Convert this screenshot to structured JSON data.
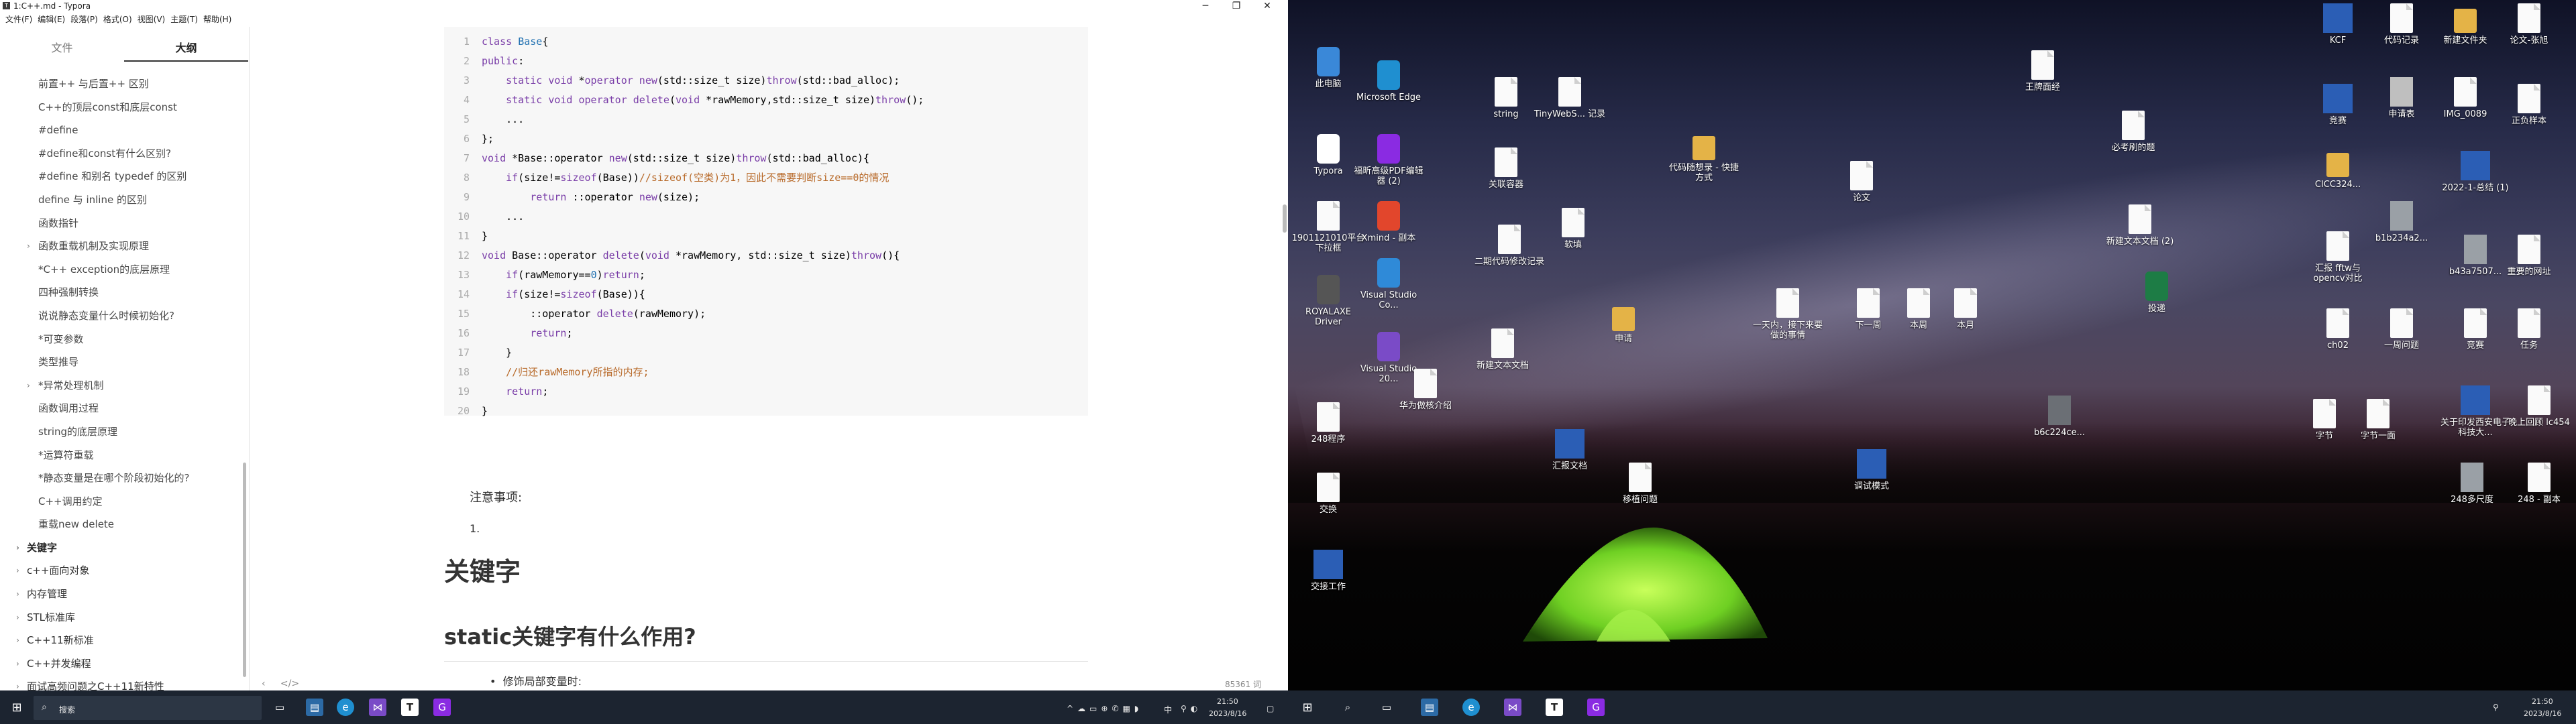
{
  "window": {
    "title": "1:C++.md - Typora",
    "icon": "T"
  },
  "menu": [
    "文件(F)",
    "编辑(E)",
    "段落(P)",
    "格式(O)",
    "视图(V)",
    "主题(T)",
    "帮助(H)"
  ],
  "sidebar": {
    "tabs": [
      "文件",
      "大纲"
    ],
    "outline": [
      {
        "label": "前置++ 与后置++ 区别",
        "level": 2
      },
      {
        "label": "C++的顶层const和底层const",
        "level": 2
      },
      {
        "label": "#define",
        "level": 2
      },
      {
        "label": "#define和const有什么区别?",
        "level": 2
      },
      {
        "label": "#define 和别名 typedef 的区别",
        "level": 2
      },
      {
        "label": "define 与 inline 的区别",
        "level": 2
      },
      {
        "label": "函数指针",
        "level": 2
      },
      {
        "label": "函数重载机制及实现原理",
        "level": 2,
        "arrow": "›"
      },
      {
        "label": "*C++ exception的底层原理",
        "level": 2
      },
      {
        "label": "四种强制转换",
        "level": 2
      },
      {
        "label": "说说静态变量什么时候初始化?",
        "level": 2
      },
      {
        "label": "*可变参数",
        "level": 2
      },
      {
        "label": "类型推导",
        "level": 2
      },
      {
        "label": "*异常处理机制",
        "level": 2,
        "arrow": "›"
      },
      {
        "label": "函数调用过程",
        "level": 2
      },
      {
        "label": "string的底层原理",
        "level": 2
      },
      {
        "label": "*运算符重载",
        "level": 2
      },
      {
        "label": "*静态变量是在哪个阶段初始化的?",
        "level": 2
      },
      {
        "label": "C++调用约定",
        "level": 2
      },
      {
        "label": "重载new delete",
        "level": 2
      },
      {
        "label": "关键字",
        "level": 1,
        "arrow": "›",
        "bold": true
      },
      {
        "label": "c++面向对象",
        "level": 1,
        "arrow": "›"
      },
      {
        "label": "内存管理",
        "level": 1,
        "arrow": "›"
      },
      {
        "label": "STL标准库",
        "level": 1,
        "arrow": "›"
      },
      {
        "label": "C++11新标准",
        "level": 1,
        "arrow": "›"
      },
      {
        "label": "C++并发编程",
        "level": 1,
        "arrow": "›"
      },
      {
        "label": "面试高频问题之C++11新特性",
        "level": 1,
        "arrow": "›"
      }
    ]
  },
  "code": [
    {
      "n": "1",
      "parts": [
        [
          "kw",
          "class "
        ],
        [
          "cls",
          "Base"
        ],
        [
          "",
          "{"
        ]
      ]
    },
    {
      "n": "2",
      "parts": [
        [
          "kw",
          "public"
        ],
        [
          "",
          ":"
        ]
      ]
    },
    {
      "n": "3",
      "parts": [
        [
          "",
          "    "
        ],
        [
          "kw",
          "static void "
        ],
        [
          "",
          "*"
        ],
        [
          "kw",
          "operator new"
        ],
        [
          "",
          "(std::size_t size)"
        ],
        [
          "kw",
          "throw"
        ],
        [
          "",
          "(std::bad_alloc);"
        ]
      ]
    },
    {
      "n": "4",
      "parts": [
        [
          "",
          "    "
        ],
        [
          "kw",
          "static void operator delete"
        ],
        [
          "",
          "("
        ],
        [
          "kw",
          "void"
        ],
        [
          "",
          " *rawMemory,std::size_t size)"
        ],
        [
          "kw",
          "throw"
        ],
        [
          "",
          "();"
        ]
      ]
    },
    {
      "n": "5",
      "parts": [
        [
          "",
          "    ..."
        ]
      ]
    },
    {
      "n": "6",
      "parts": [
        [
          "",
          "};"
        ]
      ]
    },
    {
      "n": "7",
      "parts": [
        [
          "kw",
          "void "
        ],
        [
          "",
          "*Base::operator "
        ],
        [
          "kw",
          "new"
        ],
        [
          "",
          "(std::size_t size)"
        ],
        [
          "kw",
          "throw"
        ],
        [
          "",
          "(std::bad_alloc){"
        ]
      ]
    },
    {
      "n": "8",
      "parts": [
        [
          "",
          "    "
        ],
        [
          "kw",
          "if"
        ],
        [
          "",
          "(size!="
        ],
        [
          "kw",
          "sizeof"
        ],
        [
          "",
          "(Base))"
        ],
        [
          "cm",
          "//sizeof(空类)为1，因此不需要判断size==0的情况"
        ]
      ]
    },
    {
      "n": "9",
      "parts": [
        [
          "",
          "        "
        ],
        [
          "kw",
          "return "
        ],
        [
          "",
          "::operator "
        ],
        [
          "kw",
          "new"
        ],
        [
          "",
          "(size);"
        ]
      ]
    },
    {
      "n": "10",
      "parts": [
        [
          "",
          "    ..."
        ]
      ]
    },
    {
      "n": "11",
      "parts": [
        [
          "",
          "}"
        ]
      ]
    },
    {
      "n": "12",
      "parts": [
        [
          "kw",
          "void "
        ],
        [
          "",
          "Base::operator "
        ],
        [
          "kw",
          "delete"
        ],
        [
          "",
          "("
        ],
        [
          "kw",
          "void"
        ],
        [
          "",
          " *rawMemory, std::size_t size)"
        ],
        [
          "kw",
          "throw"
        ],
        [
          "",
          "(){"
        ]
      ]
    },
    {
      "n": "13",
      "parts": [
        [
          "",
          "    "
        ],
        [
          "kw",
          "if"
        ],
        [
          "",
          "(rawMemory=="
        ],
        [
          "cls",
          "0"
        ],
        [
          "",
          ")"
        ],
        [
          "kw",
          "return"
        ],
        [
          "",
          ";"
        ]
      ]
    },
    {
      "n": "14",
      "parts": [
        [
          "",
          "    "
        ],
        [
          "kw",
          "if"
        ],
        [
          "",
          "(size!="
        ],
        [
          "kw",
          "sizeof"
        ],
        [
          "",
          "(Base)){"
        ]
      ]
    },
    {
      "n": "15",
      "parts": [
        [
          "",
          "        ::operator "
        ],
        [
          "kw",
          "delete"
        ],
        [
          "",
          "(rawMemory);"
        ]
      ]
    },
    {
      "n": "16",
      "parts": [
        [
          "",
          "        "
        ],
        [
          "kw",
          "return"
        ],
        [
          "",
          ";"
        ]
      ]
    },
    {
      "n": "17",
      "parts": [
        [
          "",
          "    }"
        ]
      ]
    },
    {
      "n": "18",
      "parts": [
        [
          "",
          "    "
        ],
        [
          "cm",
          "//归还rawMemory所指的内存;"
        ]
      ]
    },
    {
      "n": "19",
      "parts": [
        [
          "",
          "    "
        ],
        [
          "kw",
          "return"
        ],
        [
          "",
          ";"
        ]
      ]
    },
    {
      "n": "20",
      "parts": [
        [
          "",
          "}"
        ]
      ]
    }
  ],
  "doc": {
    "note": "注意事项:",
    "ol_num": "1.",
    "h1": "关键字",
    "h2": "static关键字有什么作用?",
    "bullet": "修饰局部变量时:",
    "word_count": "85361 词"
  },
  "taskbar_left": {
    "search": "搜索",
    "time": "21:50",
    "date": "2023/8/16",
    "ime": "中"
  },
  "taskbar_right": {
    "time": "21:50",
    "date": "2023/8/16"
  },
  "desktop_icons": [
    {
      "label": "此电脑",
      "type": "app",
      "color": "#3a88d8"
    },
    {
      "label": "Microsoft Edge",
      "type": "app",
      "color": "#1f8fd0"
    },
    {
      "label": "Typora",
      "type": "app",
      "color": "#ffffff"
    },
    {
      "label": "福昕高级PDF编辑器 (2)",
      "type": "app",
      "color": "#8a2be2"
    },
    {
      "label": "1901121010平台下拉框",
      "type": "doc",
      "color": "#fafafa"
    },
    {
      "label": "Xmind - 副本",
      "type": "app",
      "color": "#e2462c"
    },
    {
      "label": "ROYALAXE Driver",
      "type": "app",
      "color": "#555"
    },
    {
      "label": "Visual Studio Co...",
      "type": "app",
      "color": "#2f8ad8"
    },
    {
      "label": "Visual Studio 20...",
      "type": "app",
      "color": "#7a4bc7"
    },
    {
      "label": "华为做核介绍",
      "type": "doc",
      "color": "#fafafa"
    },
    {
      "label": "248程序",
      "type": "doc",
      "color": "#fafafa"
    },
    {
      "label": "交换",
      "type": "doc",
      "color": "#fafafa"
    },
    {
      "label": "交接工作",
      "type": "word",
      "color": "#2b5eb5"
    },
    {
      "label": "string",
      "type": "doc",
      "color": "#fafafa"
    },
    {
      "label": "TinyWebS... 记录",
      "type": "doc",
      "color": "#fafafa"
    },
    {
      "label": "关联容器",
      "type": "doc",
      "color": "#fafafa"
    },
    {
      "label": "二期代码修改记录",
      "type": "doc",
      "color": "#fafafa"
    },
    {
      "label": "软填",
      "type": "doc",
      "color": "#fafafa"
    },
    {
      "label": "新建文本文档",
      "type": "doc",
      "color": "#fafafa"
    },
    {
      "label": "申请",
      "type": "folder",
      "color": "#e4b347"
    },
    {
      "label": "汇报文档",
      "type": "word",
      "color": "#2b5eb5"
    },
    {
      "label": "移植问题",
      "type": "doc",
      "color": "#fafafa"
    },
    {
      "label": "代码随想录 - 快捷方式",
      "type": "folder",
      "color": "#e4b347"
    },
    {
      "label": "论文",
      "type": "doc",
      "color": "#fafafa"
    },
    {
      "label": "一天内，接下来要做的事情",
      "type": "doc",
      "color": "#fafafa"
    },
    {
      "label": "下一周",
      "type": "doc",
      "color": "#fafafa"
    },
    {
      "label": "本周",
      "type": "doc",
      "color": "#fafafa"
    },
    {
      "label": "本月",
      "type": "doc",
      "color": "#fafafa"
    },
    {
      "label": "调试模式",
      "type": "word",
      "color": "#2b5eb5"
    },
    {
      "label": "王牌面经",
      "type": "doc",
      "color": "#fafafa"
    },
    {
      "label": "必考刷的题",
      "type": "doc",
      "color": "#fafafa"
    },
    {
      "label": "新建文本文档 (2)",
      "type": "doc",
      "color": "#fafafa"
    },
    {
      "label": "投递",
      "type": "app",
      "color": "#1d7c45"
    },
    {
      "label": "b6c224ce...",
      "type": "img",
      "color": "#6b6f75"
    },
    {
      "label": "KCF",
      "type": "word",
      "color": "#2b5eb5"
    },
    {
      "label": "代码记录",
      "type": "doc",
      "color": "#fafafa"
    },
    {
      "label": "新建文件夹",
      "type": "folder",
      "color": "#e4b347"
    },
    {
      "label": "论文-张旭",
      "type": "doc",
      "color": "#fafafa"
    },
    {
      "label": "竞赛",
      "type": "word",
      "color": "#2b5eb5"
    },
    {
      "label": "申请表",
      "type": "img",
      "color": "#bfbfbf"
    },
    {
      "label": "IMG_0089",
      "type": "doc",
      "color": "#fafafa"
    },
    {
      "label": "正负样本",
      "type": "doc",
      "color": "#fafafa"
    },
    {
      "label": "CICC324...",
      "type": "folder",
      "color": "#e4b347"
    },
    {
      "label": "2022-1-总结 (1)",
      "type": "word",
      "color": "#2b5eb5"
    },
    {
      "label": "汇报 fftw与opencv对比",
      "type": "doc",
      "color": "#fafafa"
    },
    {
      "label": "b1b234a2...",
      "type": "img",
      "color": "#9aa0a6"
    },
    {
      "label": "b43a7507...",
      "type": "img",
      "color": "#9aa0a6"
    },
    {
      "label": "重要的网址",
      "type": "doc",
      "color": "#fafafa"
    },
    {
      "label": "ch02",
      "type": "doc",
      "color": "#fafafa"
    },
    {
      "label": "一周问题",
      "type": "doc",
      "color": "#fafafa"
    },
    {
      "label": "竞赛",
      "type": "doc",
      "color": "#fafafa"
    },
    {
      "label": "任务",
      "type": "doc",
      "color": "#fafafa"
    },
    {
      "label": "关于印发西安电子科技大...",
      "type": "word",
      "color": "#2b5eb5"
    },
    {
      "label": "晚上回顾 lc454",
      "type": "doc",
      "color": "#fafafa"
    },
    {
      "label": "字节",
      "type": "doc",
      "color": "#fafafa"
    },
    {
      "label": "字节一面",
      "type": "doc",
      "color": "#fafafa"
    },
    {
      "label": "248多尺度",
      "type": "img",
      "color": "#9aa0a6"
    },
    {
      "label": "248 - 副本",
      "type": "doc",
      "color": "#fafafa"
    }
  ]
}
